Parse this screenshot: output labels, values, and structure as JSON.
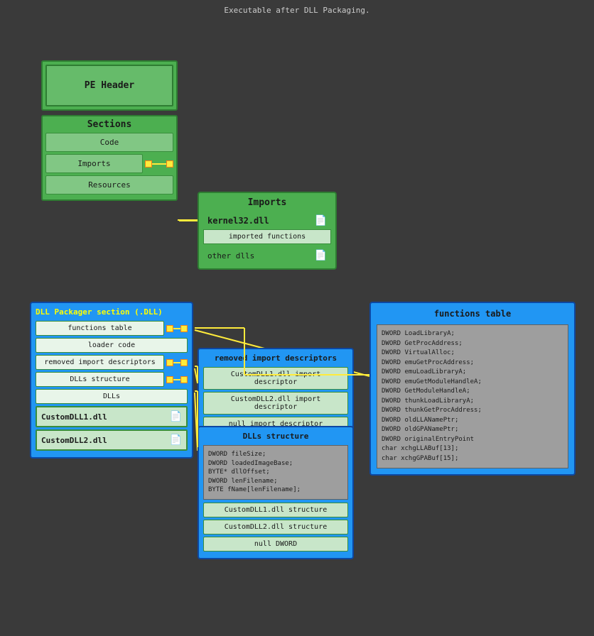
{
  "title": "Executable after DLL Packaging.",
  "pe_header": {
    "label": "PE Header"
  },
  "sections": {
    "label": "Sections",
    "items": [
      "Code",
      "Imports",
      "Resources"
    ]
  },
  "imports_box": {
    "title": "Imports",
    "kernel": "kernel32.dll",
    "imported_functions": "imported functions",
    "other_dlls": "other dlls"
  },
  "dll_packager": {
    "title": "DLL Packager section (.DLL)",
    "items": [
      "functions table",
      "loader code",
      "removed import descriptors",
      "DLLs structure",
      "DLLs"
    ],
    "dll1": "CustomDLL1.dll",
    "dll2": "CustomDLL2.dll"
  },
  "removed_imports": {
    "title": "removed import descriptors",
    "items": [
      "CustomDLL1.dll import descriptor",
      "CustomDLL2.dll import descriptor",
      "null import descriptor"
    ]
  },
  "dlls_structure": {
    "title": "DLLs structure",
    "code": "DWORD fileSize;\nDWORD loadedImageBase;\nBYTE* dllOffset;\nDWORD lenFilename;\nBYTE fName[lenFilename];",
    "items": [
      "CustomDLL1.dll structure",
      "CustomDLL2.dll structure",
      "null DWORD"
    ]
  },
  "functions_table": {
    "title": "functions table",
    "entries": [
      "DWORD LoadLibraryA;",
      "DWORD GetProcAddress;",
      "DWORD VirtualAlloc;",
      "DWORD emuGetProcAddress;",
      "DWORD emuLoadLibraryA;",
      "DWORD emuGetModuleHandleA;",
      "DWORD GetModuleHandleA;",
      "DWORD thunkLoadLibraryA;",
      "DWORD thunkGetProcAddress;",
      "DWORD oldLLANamePtr;",
      "DWORD oldGPANamePtr;",
      "DWORD originalEntryPoint",
      "char xchgLLABuf[13];",
      "char xchgGPABuf[15];"
    ]
  }
}
